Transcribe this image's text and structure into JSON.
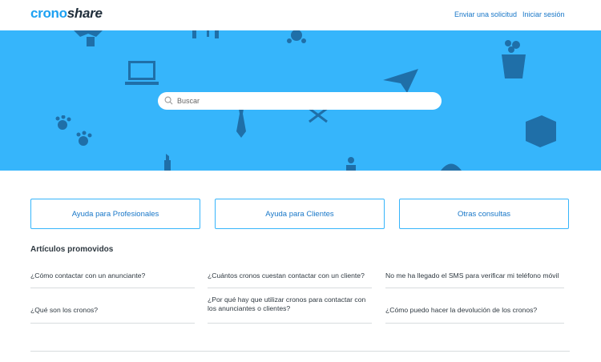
{
  "header": {
    "logo_part1": "crono",
    "logo_part2": "share",
    "submit_request": "Enviar una solicitud",
    "sign_in": "Iniciar sesión"
  },
  "hero": {
    "background_color": "#36b5fb",
    "search": {
      "placeholder": "Buscar"
    }
  },
  "categories": [
    {
      "label": "Ayuda para Profesionales"
    },
    {
      "label": "Ayuda para Clientes"
    },
    {
      "label": "Otras consultas"
    }
  ],
  "promoted": {
    "title": "Artículos promovidos",
    "articles": [
      {
        "title": "¿Cómo contactar con un anunciante?"
      },
      {
        "title": "¿Cuántos cronos cuestan contactar con un cliente?"
      },
      {
        "title": "No me ha llegado el SMS para verificar mi teléfono móvil"
      },
      {
        "title": "¿Qué son los cronos?"
      },
      {
        "title": "¿Por qué hay que utilizar cronos para contactar con los anunciantes o clientes?"
      },
      {
        "title": "¿Cómo puedo hacer la devolución de los cronos?"
      }
    ]
  }
}
